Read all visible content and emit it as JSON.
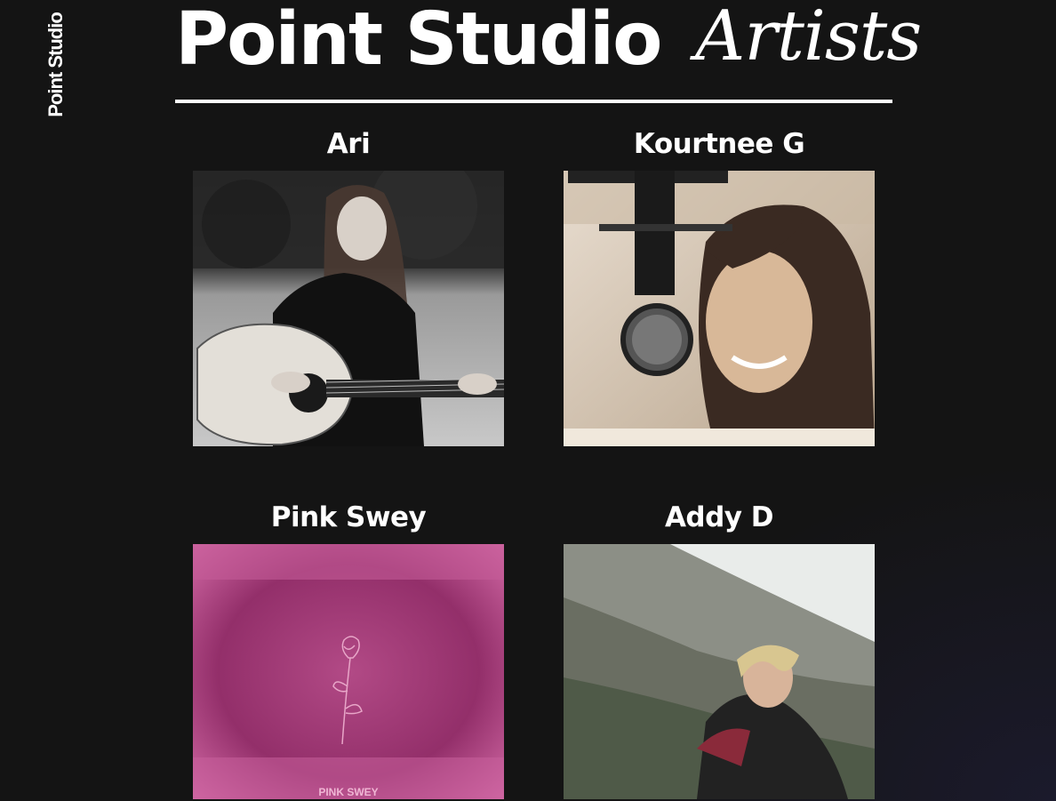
{
  "side_logo": "Point Studio",
  "header": {
    "title": "Point Studio",
    "script": "Artists"
  },
  "artists": [
    {
      "name": "Ari",
      "photo": "guitarist-photo"
    },
    {
      "name": "Kourtnee G",
      "photo": "microphone-singer-photo"
    },
    {
      "name": "Pink Swey",
      "photo": "rose-album-cover",
      "cover_text": "PINK SWEY"
    },
    {
      "name": "Addy D",
      "photo": "mountain-portrait-photo"
    }
  ]
}
